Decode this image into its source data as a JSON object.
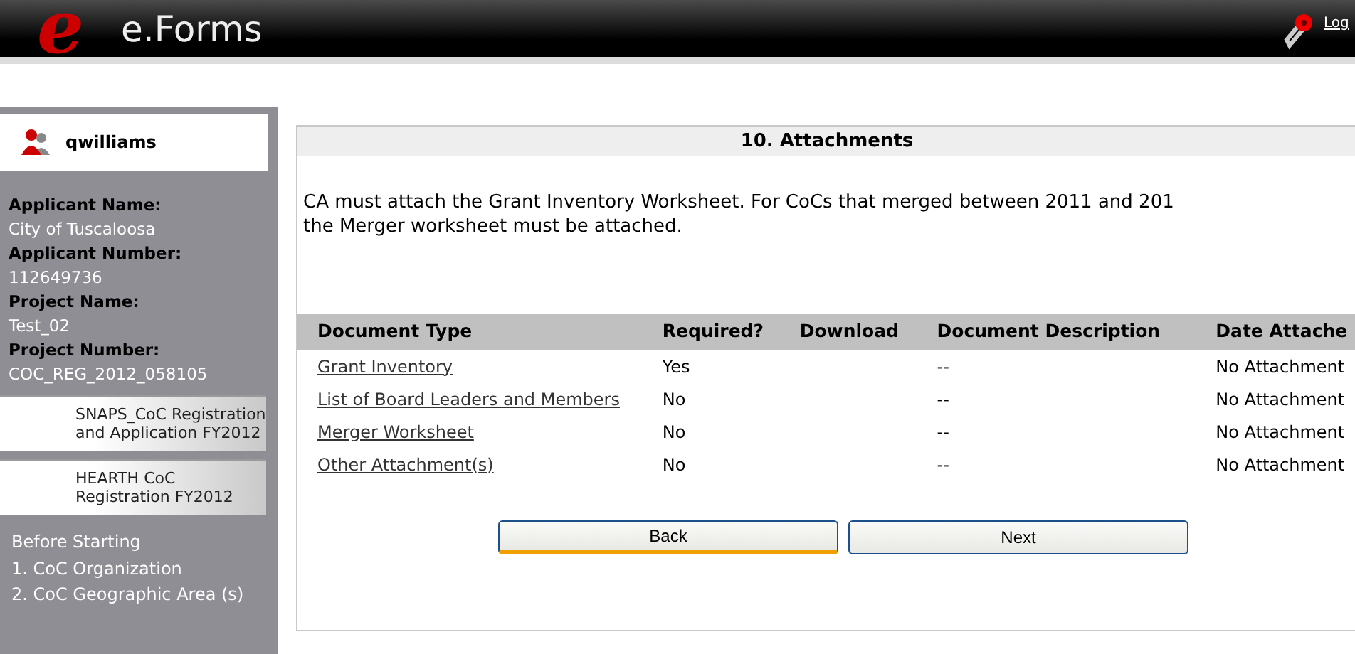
{
  "header": {
    "logo_letter": "e",
    "title": "e.Forms",
    "logout": "Log"
  },
  "sidebar": {
    "user": "qwilliams",
    "details": [
      {
        "label": "Applicant Name:",
        "value": "City of Tuscaloosa"
      },
      {
        "label": "Applicant Number:",
        "value": "112649736"
      },
      {
        "label": "Project Name:",
        "value": "Test_02"
      },
      {
        "label": "Project Number:",
        "value": "COC_REG_2012_058105"
      }
    ],
    "applications": [
      "SNAPS_CoC Registration and Application FY2012",
      "HEARTH CoC Registration FY2012"
    ],
    "menu": [
      "Before Starting",
      "1. CoC Organization",
      "2. CoC Geographic Area (s)"
    ]
  },
  "panel": {
    "title": "10. Attachments",
    "instructions": [
      "CA must attach the Grant Inventory Worksheet. For CoCs that merged between 2011 and 201",
      "the Merger worksheet must be attached."
    ],
    "table": {
      "columns": [
        "Document Type",
        "Required?",
        "Download",
        "Document Description",
        "Date Attache"
      ],
      "rows": [
        [
          "Grant Inventory",
          "Yes",
          "",
          "--",
          "No Attachment"
        ],
        [
          "List of Board Leaders and Members",
          "No",
          "",
          "--",
          "No Attachment"
        ],
        [
          "Merger Worksheet",
          "No",
          "",
          "--",
          "No Attachment"
        ],
        [
          "Other Attachment(s)",
          "No",
          "",
          "--",
          "No Attachment"
        ]
      ]
    },
    "buttons": [
      {
        "label": "Back",
        "focused": true
      },
      {
        "label": "Next",
        "focused": false
      }
    ]
  }
}
